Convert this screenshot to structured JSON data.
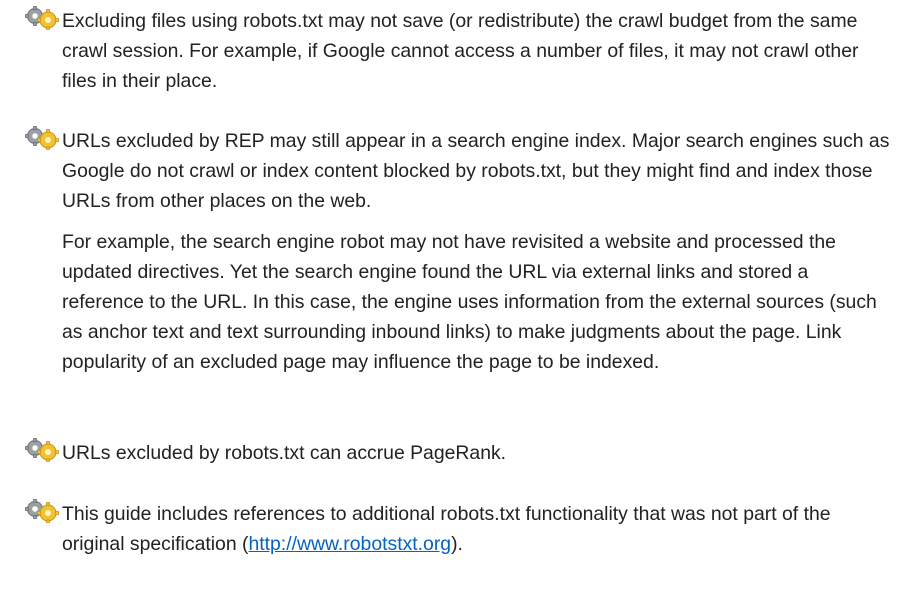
{
  "notes": [
    {
      "icon": "gears-icon",
      "text": "Excluding files using robots.txt may not save (or redistribute) the crawl budget from the same crawl session. For example, if Google cannot access a number of files, it may not crawl other files in their place."
    },
    {
      "icon": "gears-icon",
      "text": "URLs excluded by REP may still appear in a search engine index. Major search engines such as Google do not crawl or index content blocked by robots.txt, but they might find and index those URLs from other places on the web.",
      "continuation": "For example, the search engine robot may not have revisited a website and processed the updated directives. Yet the search engine found the URL via external links and stored a reference to the URL. In this case, the engine uses information from the external sources (such as anchor text and text surrounding inbound links) to make judgments about the page. Link popularity of an excluded page may influence the page to be indexed."
    },
    {
      "icon": "gears-icon",
      "text": "URLs excluded by robots.txt can accrue PageRank."
    },
    {
      "icon": "gears-icon",
      "text_before_link": "This guide includes references to additional robots.txt functionality that was not part of the original specification (",
      "link": "http://www.robotstxt.org",
      "text_after_link": ")."
    }
  ],
  "colors": {
    "text": "#222222",
    "link": "#0563c1",
    "background": "#ffffff"
  }
}
